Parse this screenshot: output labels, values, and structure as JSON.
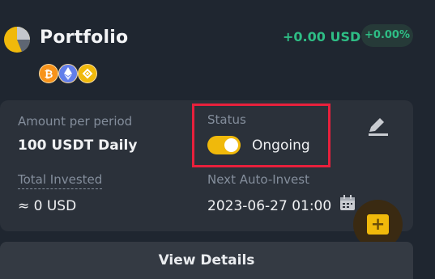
{
  "header": {
    "title": "Portfolio",
    "pnl_value": "+0.00 USD",
    "pnl_percent": "+0.00%",
    "icon": "portfolio-pie-icon"
  },
  "coins": [
    {
      "name": "bitcoin-icon",
      "symbol": "₿",
      "color": "#f7931a"
    },
    {
      "name": "ethereum-icon",
      "symbol": "◆",
      "color": "#627eea"
    },
    {
      "name": "bnb-icon",
      "symbol": "◈",
      "color": "#f0b90b"
    }
  ],
  "plan": {
    "amount_label": "Amount per period",
    "amount_value": "100 USDT Daily",
    "status_label": "Status",
    "status_value": "Ongoing",
    "status_on": true,
    "total_label": "Total Invested",
    "total_value": "≈ 0 USD",
    "next_label": "Next Auto-Invest",
    "next_value": "2023-06-27 01:00"
  },
  "actions": {
    "view_details": "View Details",
    "fab_icon": "plus-icon",
    "edit_icon": "edit-icon",
    "calendar_icon": "calendar-icon"
  },
  "colors": {
    "accent": "#f0b90b",
    "positive": "#2ebd85",
    "highlight": "#e8203c",
    "background": "#1f2630",
    "card": "#2b313a"
  }
}
